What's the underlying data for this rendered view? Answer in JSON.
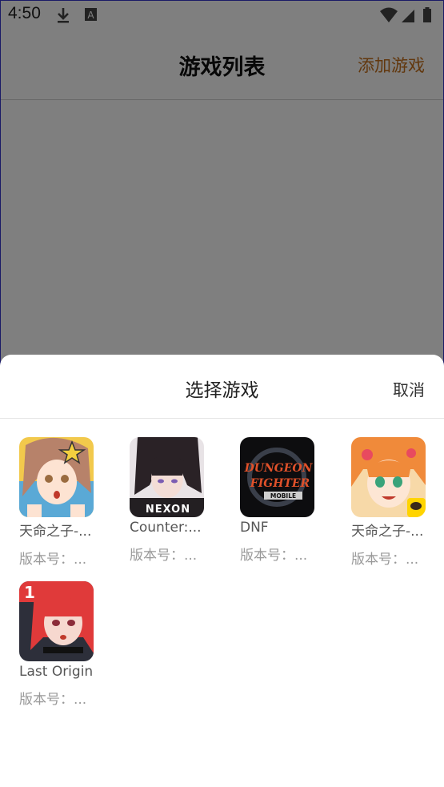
{
  "status_bar": {
    "time": "4:50",
    "icons": [
      "download-icon",
      "a-notification-icon",
      "wifi-icon",
      "cell-signal-icon",
      "battery-icon"
    ]
  },
  "app_bar": {
    "title": "游戏列表",
    "add_label": "添加游戏",
    "add_color": "#c46f1b"
  },
  "sheet": {
    "title": "选择游戏",
    "cancel_label": "取消",
    "games": [
      {
        "name": "天命之子-...",
        "version": "版本号：...",
        "icon": "anime-girl-icon"
      },
      {
        "name": "Counter:...",
        "version": "版本号：...",
        "icon": "nexon-icon",
        "icon_text": "NEXON"
      },
      {
        "name": "DNF",
        "version": "版本号：...",
        "icon": "dungeon-fighter-icon",
        "icon_text_1": "DUNGEON",
        "icon_text_2": "FIGHTER",
        "icon_text_3": "MOBILE"
      },
      {
        "name": "天命之子-...",
        "version": "版本号：...",
        "icon": "anime-girl-chat-icon"
      },
      {
        "name": "Last Origin",
        "version": "版本号：...",
        "icon": "last-origin-icon",
        "badge": "1"
      }
    ]
  }
}
